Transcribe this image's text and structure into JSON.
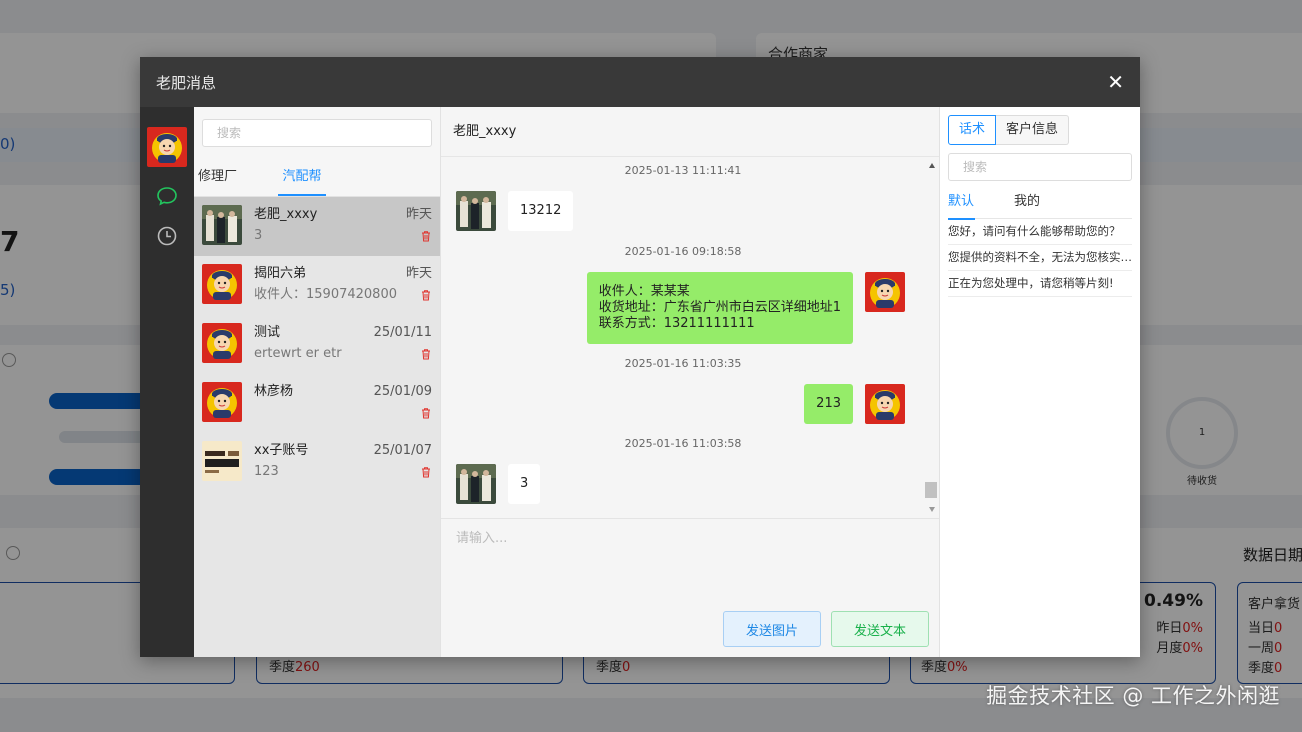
{
  "background": {
    "partner_label": "合作商家",
    "paren_1": "0)",
    "big_digit": "7",
    "paren_2": "5)",
    "gauge_value": "1",
    "gauge_label": "待收货",
    "data_date_label": "数据日期",
    "stat_percent": "0.49%",
    "stat_yesterday_label": "昨日",
    "stat_yesterday_value": "0%",
    "stat_month_label": "月度",
    "stat_month_value": "0%",
    "customer_label": "客户拿货",
    "day_label": "当日",
    "day_value": "0",
    "week_label": "一周",
    "week_value": "0",
    "quarter_label": "季度",
    "quarter_value_a": "260",
    "quarter_value_b": "0",
    "quarter_value_c": "0%",
    "quarter_value_d": "0"
  },
  "watermark": "掘金技术社区 @ 工作之外闲逛",
  "modal": {
    "title": "老肥消息",
    "close_glyph": "✕"
  },
  "contacts": {
    "search_placeholder": "搜索",
    "tabs": [
      "修理厂",
      "汽配帮"
    ],
    "items": [
      {
        "name": "老肥_xxxy",
        "time": "昨天",
        "preview": "3"
      },
      {
        "name": "揭阳六弟",
        "time": "昨天",
        "preview": "收件人：15907420800"
      },
      {
        "name": "测试",
        "time": "25/01/11",
        "preview": "ertewrt er etr"
      },
      {
        "name": "林彦杨",
        "time": "25/01/09",
        "preview": ""
      },
      {
        "name": "xx子账号",
        "time": "25/01/07",
        "preview": "123"
      }
    ]
  },
  "chat": {
    "title": "老肥_xxxy",
    "messages": [
      {
        "time": "2025-01-13 11:11:41",
        "side": "left",
        "text": "13212"
      },
      {
        "time": "2025-01-16 09:18:58",
        "side": "right",
        "lines": [
          "收件人：某某某",
          "收货地址：广东省广州市白云区详细地址1",
          "联系方式：13211111111"
        ]
      },
      {
        "time": "2025-01-16 11:03:35",
        "side": "right",
        "text": "213"
      },
      {
        "time": "2025-01-16 11:03:58",
        "side": "left",
        "text": "3"
      }
    ],
    "input_placeholder": "请输入...",
    "send_image_label": "发送图片",
    "send_text_label": "发送文本"
  },
  "side_panel": {
    "tabs": [
      "话术",
      "客户信息"
    ],
    "search_placeholder": "搜索",
    "phrase_tabs": [
      "默认",
      "我的"
    ],
    "phrases": [
      "您好，请问有什么能够帮助您的？",
      "您提供的资料不全，无法为您核实，请补充信息",
      "正在为您处理中，请您稍等片刻!"
    ]
  },
  "colors": {
    "accent": "#1e90ff",
    "self_bubble": "#95ec69",
    "header_dark": "#393939",
    "rail_dark": "#2e2e2e",
    "danger": "#e02020"
  }
}
